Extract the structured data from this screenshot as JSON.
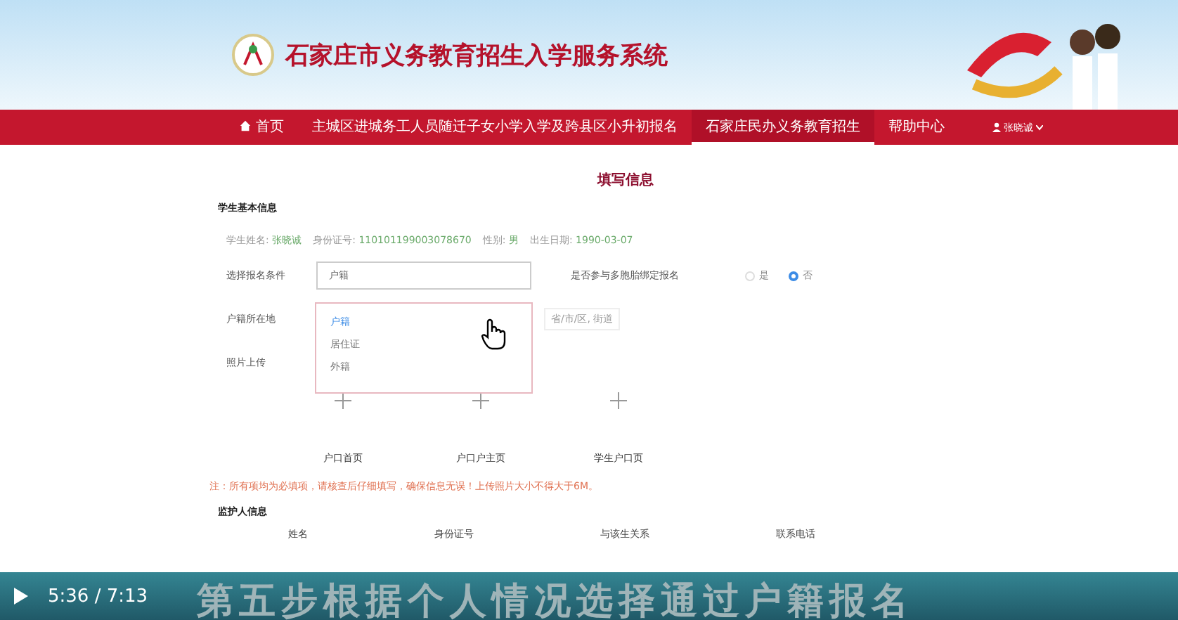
{
  "header": {
    "title": "石家庄市义务教育招生入学服务系统"
  },
  "nav": [
    {
      "label": "首页",
      "selected": false
    },
    {
      "label": "主城区进城务工人员随迁子女小学入学及跨县区小升初报名",
      "selected": false
    },
    {
      "label": "石家庄民办义务教育招生",
      "selected": true
    },
    {
      "label": "帮助中心",
      "selected": false
    }
  ],
  "user": {
    "name": "张晓诚"
  },
  "page_title": "填写信息",
  "student_section": {
    "title": "学生基本信息",
    "facts": [
      {
        "label": "学生姓名:",
        "value": "张晓诚"
      },
      {
        "label": "身份证号:",
        "value": "110101199003078670"
      },
      {
        "label": "性别:",
        "value": "男"
      },
      {
        "label": "出生日期:",
        "value": "1990-03-07"
      }
    ]
  },
  "condition": {
    "label": "选择报名条件",
    "value": "户籍",
    "options": [
      {
        "label": "户籍",
        "selected": true
      },
      {
        "label": "居住证",
        "selected": false
      },
      {
        "label": "外籍",
        "selected": false
      }
    ]
  },
  "multi_child": {
    "label": "是否参与多胞胎绑定报名",
    "options": [
      {
        "label": "是",
        "selected": false
      },
      {
        "label": "否",
        "selected": true
      }
    ]
  },
  "residence": {
    "label": "户籍所在地",
    "placeholder": "省/市/区, 街道"
  },
  "photos": {
    "label": "照片上传",
    "slots": [
      "户口首页",
      "户口户主页",
      "学生户口页"
    ]
  },
  "note": "注：所有项均为必填项，请核查后仔细填写，确保信息无误！上传照片大小不得大于6M。",
  "guardian_section": {
    "title": "监护人信息",
    "columns": [
      "姓名",
      "身份证号",
      "与该生关系",
      "联系电话"
    ]
  },
  "video": {
    "caption": "第五步根据个人情况选择通过户籍报名",
    "time": "5:36 / 7:13"
  }
}
